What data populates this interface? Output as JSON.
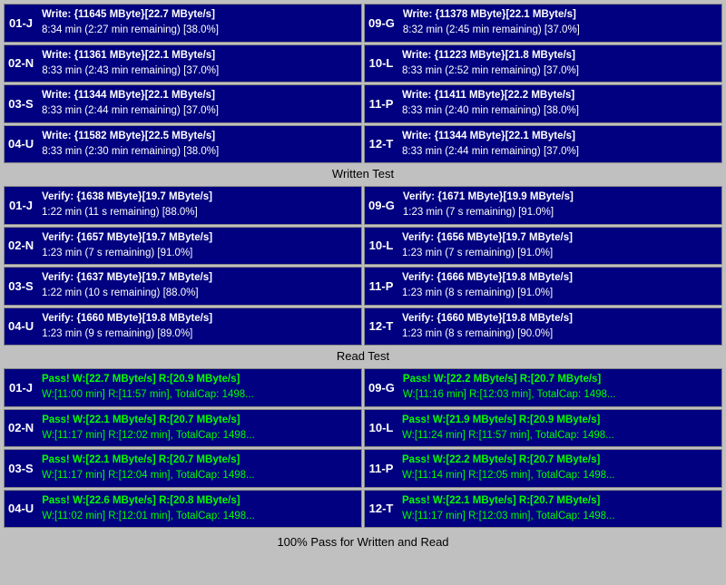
{
  "sections": {
    "write": {
      "label": "Written Test",
      "rows": [
        {
          "left": {
            "id": "01-J",
            "line1": "Write: {11645 MByte}[22.7 MByte/s]",
            "line2": "8:34 min (2:27 min remaining)  [38.0%]"
          },
          "right": {
            "id": "09-G",
            "line1": "Write: {11378 MByte}[22.1 MByte/s]",
            "line2": "8:32 min (2:45 min remaining)  [37.0%]"
          }
        },
        {
          "left": {
            "id": "02-N",
            "line1": "Write: {11361 MByte}[22.1 MByte/s]",
            "line2": "8:33 min (2:43 min remaining)  [37.0%]"
          },
          "right": {
            "id": "10-L",
            "line1": "Write: {11223 MByte}[21.8 MByte/s]",
            "line2": "8:33 min (2:52 min remaining)  [37.0%]"
          }
        },
        {
          "left": {
            "id": "03-S",
            "line1": "Write: {11344 MByte}[22.1 MByte/s]",
            "line2": "8:33 min (2:44 min remaining)  [37.0%]"
          },
          "right": {
            "id": "11-P",
            "line1": "Write: {11411 MByte}[22.2 MByte/s]",
            "line2": "8:33 min (2:40 min remaining)  [38.0%]"
          }
        },
        {
          "left": {
            "id": "04-U",
            "line1": "Write: {11582 MByte}[22.5 MByte/s]",
            "line2": "8:33 min (2:30 min remaining)  [38.0%]"
          },
          "right": {
            "id": "12-T",
            "line1": "Write: {11344 MByte}[22.1 MByte/s]",
            "line2": "8:33 min (2:44 min remaining)  [37.0%]"
          }
        }
      ]
    },
    "verify": {
      "label": "Written Test",
      "rows": [
        {
          "left": {
            "id": "01-J",
            "line1": "Verify: {1638 MByte}[19.7 MByte/s]",
            "line2": "1:22 min (11 s remaining)   [88.0%]"
          },
          "right": {
            "id": "09-G",
            "line1": "Verify: {1671 MByte}[19.9 MByte/s]",
            "line2": "1:23 min (7 s remaining)   [91.0%]"
          }
        },
        {
          "left": {
            "id": "02-N",
            "line1": "Verify: {1657 MByte}[19.7 MByte/s]",
            "line2": "1:23 min (7 s remaining)   [91.0%]"
          },
          "right": {
            "id": "10-L",
            "line1": "Verify: {1656 MByte}[19.7 MByte/s]",
            "line2": "1:23 min (7 s remaining)   [91.0%]"
          }
        },
        {
          "left": {
            "id": "03-S",
            "line1": "Verify: {1637 MByte}[19.7 MByte/s]",
            "line2": "1:22 min (10 s remaining)   [88.0%]"
          },
          "right": {
            "id": "11-P",
            "line1": "Verify: {1666 MByte}[19.8 MByte/s]",
            "line2": "1:23 min (8 s remaining)   [91.0%]"
          }
        },
        {
          "left": {
            "id": "04-U",
            "line1": "Verify: {1660 MByte}[19.8 MByte/s]",
            "line2": "1:23 min (9 s remaining)   [89.0%]"
          },
          "right": {
            "id": "12-T",
            "line1": "Verify: {1660 MByte}[19.8 MByte/s]",
            "line2": "1:23 min (8 s remaining)   [90.0%]"
          }
        }
      ]
    },
    "read": {
      "label": "Read Test",
      "rows": [
        {
          "left": {
            "id": "01-J",
            "line1": "Pass! W:[22.7 MByte/s] R:[20.9 MByte/s]",
            "line2": "W:[11:00 min] R:[11:57 min], TotalCap: 1498..."
          },
          "right": {
            "id": "09-G",
            "line1": "Pass! W:[22.2 MByte/s] R:[20.7 MByte/s]",
            "line2": "W:[11:16 min] R:[12:03 min], TotalCap: 1498..."
          }
        },
        {
          "left": {
            "id": "02-N",
            "line1": "Pass! W:[22.1 MByte/s] R:[20.7 MByte/s]",
            "line2": "W:[11:17 min] R:[12:02 min], TotalCap: 1498..."
          },
          "right": {
            "id": "10-L",
            "line1": "Pass! W:[21.9 MByte/s] R:[20.9 MByte/s]",
            "line2": "W:[11:24 min] R:[11:57 min], TotalCap: 1498..."
          }
        },
        {
          "left": {
            "id": "03-S",
            "line1": "Pass! W:[22.1 MByte/s] R:[20.7 MByte/s]",
            "line2": "W:[11:17 min] R:[12:04 min], TotalCap: 1498..."
          },
          "right": {
            "id": "11-P",
            "line1": "Pass! W:[22.2 MByte/s] R:[20.7 MByte/s]",
            "line2": "W:[11:14 min] R:[12:05 min], TotalCap: 1498..."
          }
        },
        {
          "left": {
            "id": "04-U",
            "line1": "Pass! W:[22.6 MByte/s] R:[20.8 MByte/s]",
            "line2": "W:[11:02 min] R:[12:01 min], TotalCap: 1498..."
          },
          "right": {
            "id": "12-T",
            "line1": "Pass! W:[22.1 MByte/s] R:[20.7 MByte/s]",
            "line2": "W:[11:17 min] R:[12:03 min], TotalCap: 1498..."
          }
        }
      ]
    }
  },
  "labels": {
    "written_test": "Written Test",
    "read_test": "Read Test",
    "footer": "100% Pass for Written and Read"
  }
}
